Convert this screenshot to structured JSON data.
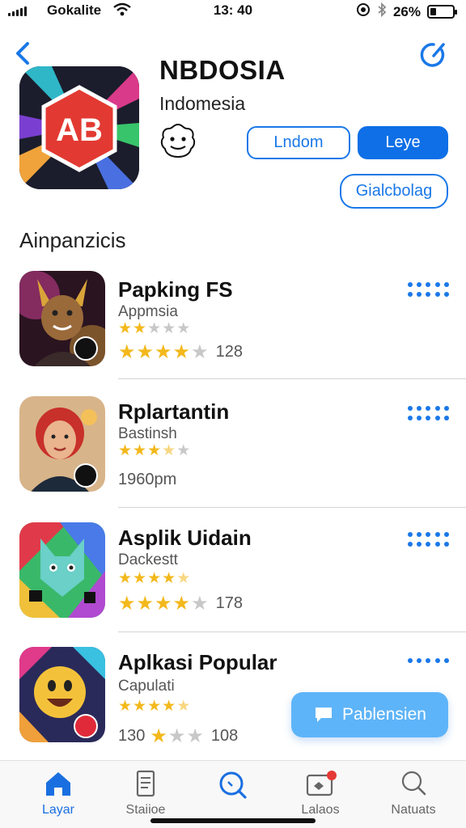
{
  "status_bar": {
    "carrier": "Gokalite",
    "time": "13: 40",
    "battery": "26%",
    "battery_level": 0.26
  },
  "header": {
    "app_name": "NBDOSIA",
    "subtitle": "Indomesia",
    "buttons": {
      "secondary": "Lndom",
      "primary": "Leye",
      "extra": "Gialcbolag"
    }
  },
  "section": {
    "title": "Ainpanzicis"
  },
  "apps": [
    {
      "name": "Papking FS",
      "category": "Appmsia",
      "rating_small": 2,
      "rating_big": 4,
      "meta": "128"
    },
    {
      "name": "Rplartantin",
      "category": "Bastinsh",
      "rating_small": 3.5,
      "meta": "1960pm"
    },
    {
      "name": "Asplik Uidain",
      "category": "Dackestt",
      "rating_small": 4.5,
      "rating_big": 4,
      "meta": "178"
    },
    {
      "name": "Aplkasi  Popular",
      "category": "Capulati",
      "rating_small": 4.5,
      "meta_prefix": "130",
      "rating_big": 1,
      "meta": "108"
    }
  ],
  "floating_button": {
    "label": "Pablensien"
  },
  "tabs": [
    {
      "label": "Layar",
      "icon": "home-icon",
      "active": true
    },
    {
      "label": "Staiioe",
      "icon": "document-icon"
    },
    {
      "label": "",
      "icon": "search-icon"
    },
    {
      "label": "Lalaos",
      "icon": "wallet-badge-icon"
    },
    {
      "label": "Natuats",
      "icon": "search-outline-icon"
    }
  ],
  "colors": {
    "accent": "#1a78e8",
    "primary_button": "#0f6fe6",
    "floating_button": "#5eb4f8",
    "star": "#f3b81c"
  }
}
